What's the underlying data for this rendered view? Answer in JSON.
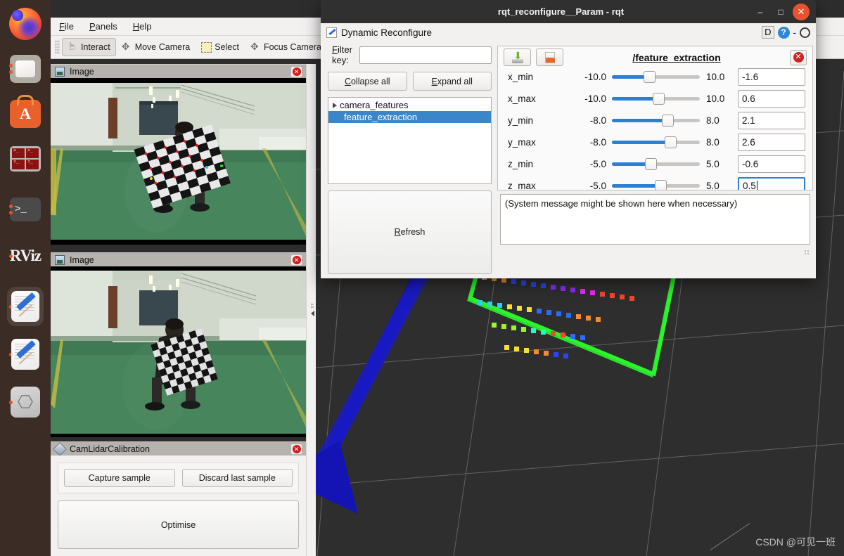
{
  "dock": {
    "items": [
      {
        "name": "firefox",
        "label": "Firefox",
        "running": false,
        "active": false
      },
      {
        "name": "files",
        "label": "Files",
        "running": true,
        "active": false
      },
      {
        "name": "software",
        "label": "Ubuntu Software",
        "running": false,
        "active": false
      },
      {
        "name": "terminator",
        "label": "Terminator",
        "running": false,
        "active": false
      },
      {
        "name": "terminal",
        "label": "Terminal",
        "running": true,
        "active": false
      },
      {
        "name": "rviz",
        "label": "RViz",
        "running": true,
        "active": false
      },
      {
        "name": "text-editor-1",
        "label": "Text Editor",
        "running": true,
        "active": true
      },
      {
        "name": "text-editor-2",
        "label": "Text Editor",
        "running": true,
        "active": false
      },
      {
        "name": "usb-drive",
        "label": "USB Drive",
        "running": true,
        "active": false
      }
    ]
  },
  "rviz": {
    "menu": [
      "File",
      "Panels",
      "Help"
    ],
    "toolbar": [
      {
        "label": "Interact",
        "icon": "hand-icon",
        "checked": true
      },
      {
        "label": "Move Camera",
        "icon": "move-camera-icon",
        "checked": false
      },
      {
        "label": "Select",
        "icon": "select-icon",
        "checked": false
      },
      {
        "label": "Focus Camera",
        "icon": "focus-camera-icon",
        "checked": false
      }
    ],
    "panels": {
      "image_top": {
        "title": "Image"
      },
      "image_bottom": {
        "title": "Image"
      },
      "calibration": {
        "title": "CamLidarCalibration",
        "capture_label": "Capture sample",
        "discard_label": "Discard last sample",
        "optimise_label": "Optimise"
      }
    }
  },
  "rqt": {
    "window_title": "rqt_reconfigure__Param - rqt",
    "window_controls": {
      "minimize": "–",
      "maximize": "□",
      "close": "✕"
    },
    "dock": {
      "title": "Dynamic Reconfigure",
      "badge_d": "D",
      "badge_help": "?",
      "badge_minus": "-",
      "badge_o": "O"
    },
    "filter": {
      "label": "Filter key:",
      "value": "",
      "placeholder": ""
    },
    "buttons": {
      "collapse_all": "Collapse all",
      "expand_all": "Expand all",
      "refresh": "Refresh"
    },
    "tree": [
      {
        "label": "camera_features",
        "selected": false,
        "expandable": true
      },
      {
        "label": "feature_extraction",
        "selected": true,
        "expandable": false
      }
    ],
    "node_name": "/feature_extraction",
    "param_toolbar": {
      "save_icon": "save-icon",
      "open_icon": "open-folder-icon",
      "close_icon": "close-node-icon"
    },
    "parameters": [
      {
        "name": "x_min",
        "min": "-10.0",
        "max": "10.0",
        "value": "-1.6",
        "ratio": 0.42,
        "focused": false
      },
      {
        "name": "x_max",
        "min": "-10.0",
        "max": "10.0",
        "value": "0.6",
        "ratio": 0.53,
        "focused": false
      },
      {
        "name": "y_min",
        "min": "-8.0",
        "max": "8.0",
        "value": "2.1",
        "ratio": 0.63,
        "focused": false
      },
      {
        "name": "y_max",
        "min": "-8.0",
        "max": "8.0",
        "value": "2.6",
        "ratio": 0.66,
        "focused": false
      },
      {
        "name": "z_min",
        "min": "-5.0",
        "max": "5.0",
        "value": "-0.6",
        "ratio": 0.44,
        "focused": false
      },
      {
        "name": "z_max",
        "min": "-5.0",
        "max": "5.0",
        "value": "0.5",
        "ratio": 0.55,
        "focused": true
      }
    ],
    "system_message": "(System message might be shown here when necessary)"
  },
  "watermark": "CSDN @可见一班",
  "colors": {
    "accent_blue": "#2f7fd0",
    "selection_blue": "#3b86c8",
    "ubuntu_orange": "#e95420",
    "close_red": "#e8522e",
    "panel_grey": "#f2f1f0",
    "titlebar_dark": "#303030",
    "viewport_dark": "#2e2e2e",
    "cloud_green": "#2bf52b"
  }
}
